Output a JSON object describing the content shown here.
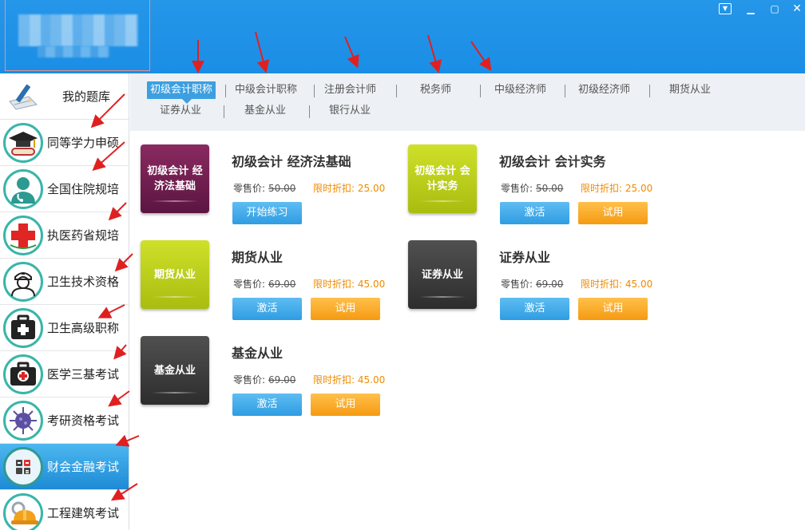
{
  "sidebar": {
    "items": [
      {
        "label": "我的题库",
        "icon": "pencil-paper-icon"
      },
      {
        "label": "同等学力申硕",
        "icon": "graduation-cap-icon"
      },
      {
        "label": "全国住院规培",
        "icon": "doctor-icon"
      },
      {
        "label": "执医药省规培",
        "icon": "red-cross-icon"
      },
      {
        "label": "卫生技术资格",
        "icon": "nurse-icon"
      },
      {
        "label": "卫生高级职称",
        "icon": "medical-kit-icon"
      },
      {
        "label": "医学三基考试",
        "icon": "first-aid-box-icon"
      },
      {
        "label": "考研资格考试",
        "icon": "virus-icon"
      },
      {
        "label": "财会金融考试",
        "icon": "calculator-icon"
      },
      {
        "label": "工程建筑考试",
        "icon": "hard-hat-icon"
      }
    ],
    "active_index": 8
  },
  "tabs": [
    "初级会计职称",
    "中级会计职称",
    "注册会计师",
    "税务师",
    "中级经济师",
    "初级经济师",
    "期货从业",
    "证券从业",
    "基金从业",
    "银行从业"
  ],
  "products": [
    {
      "thumb_text": "初级会计 经济法基础",
      "title": "初级会计 经济法基础",
      "price_label": "零售价:",
      "price": "50.00",
      "discount_label": "限时折扣:",
      "discount": "25.00",
      "primary_button": "开始练习",
      "secondary_button": ""
    },
    {
      "thumb_text": "初级会计 会计实务",
      "title": "初级会计 会计实务",
      "price_label": "零售价:",
      "price": "50.00",
      "discount_label": "限时折扣:",
      "discount": "25.00",
      "primary_button": "激活",
      "secondary_button": "试用"
    },
    {
      "thumb_text": "期货从业",
      "title": "期货从业",
      "price_label": "零售价:",
      "price": "69.00",
      "discount_label": "限时折扣:",
      "discount": "45.00",
      "primary_button": "激活",
      "secondary_button": "试用"
    },
    {
      "thumb_text": "证券从业",
      "title": "证券从业",
      "price_label": "零售价:",
      "price": "69.00",
      "discount_label": "限时折扣:",
      "discount": "45.00",
      "primary_button": "激活",
      "secondary_button": "试用"
    },
    {
      "thumb_text": "基金从业",
      "title": "基金从业",
      "price_label": "零售价:",
      "price": "69.00",
      "discount_label": "限时折扣:",
      "discount": "45.00",
      "primary_button": "激活",
      "secondary_button": "试用"
    }
  ],
  "colors": {
    "titlebar": "#1a8ee6",
    "active_tab": "#3d9fe0",
    "discount_text": "#f08a00",
    "button_blue": "#2f9ce2",
    "button_orange": "#f59a12",
    "annotation_arrow": "#e02020"
  }
}
